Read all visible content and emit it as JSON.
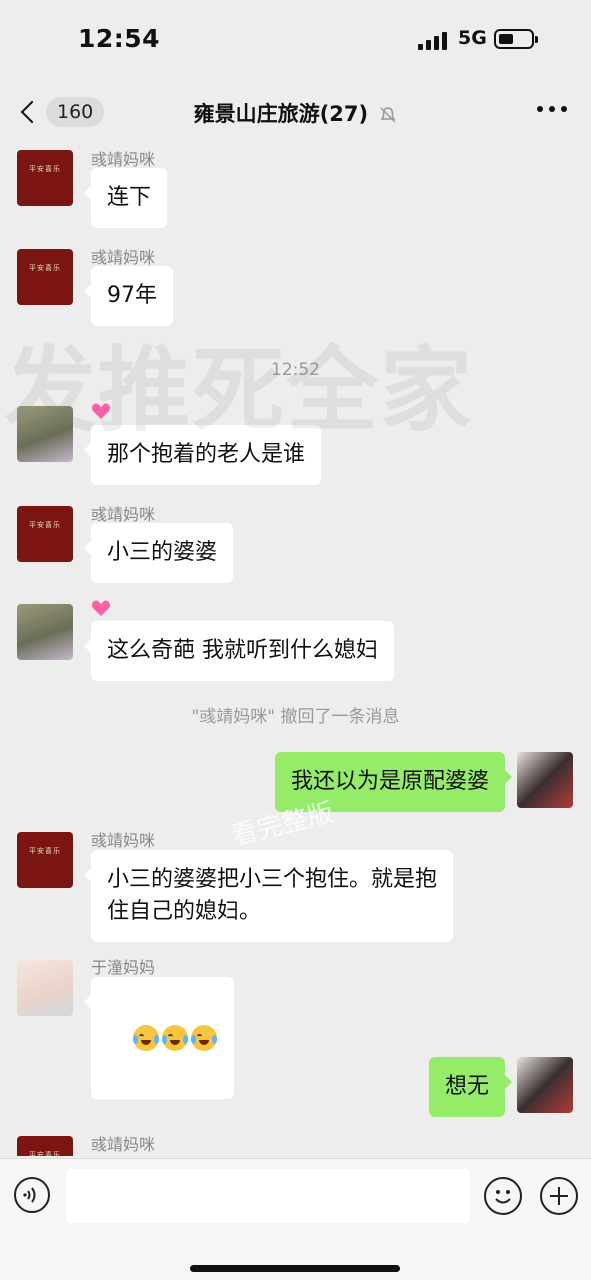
{
  "status_bar": {
    "time": "12:54",
    "network": "5G"
  },
  "nav": {
    "back_count": "160",
    "title": "雍景山庄旅游(27)"
  },
  "messages": [
    {
      "sender": "彧靖妈咪",
      "text": "连下"
    },
    {
      "sender": "彧靖妈咪",
      "text": "97年"
    },
    {
      "timestamp": "12:52"
    },
    {
      "text": "那个抱着的老人是谁"
    },
    {
      "sender": "彧靖妈咪",
      "text": "小三的婆婆"
    },
    {
      "text": "这么奇葩 我就听到什么媳妇"
    },
    {
      "system": "\"彧靖妈咪\" 撤回了一条消息"
    },
    {
      "text": "我还以为是原配婆婆"
    },
    {
      "sender": "彧靖妈咪",
      "text": "小三的婆婆把小三个抱住。就是抱\n住自己的媳妇。"
    },
    {
      "sender": "于潼妈妈",
      "emojis": [
        "crying-laughing",
        "crying-laughing",
        "crying-laughing"
      ]
    },
    {
      "text": "想无"
    },
    {
      "sender": "彧靖妈咪"
    }
  ],
  "watermark": {
    "main": "发推死全家",
    "secondary": "看完整版"
  },
  "avatar_text": "平安喜乐",
  "colors": {
    "background": "#ededed",
    "sent_bubble": "#95ec69",
    "received_bubble": "#ffffff",
    "avatar_red": "#7a1512"
  }
}
